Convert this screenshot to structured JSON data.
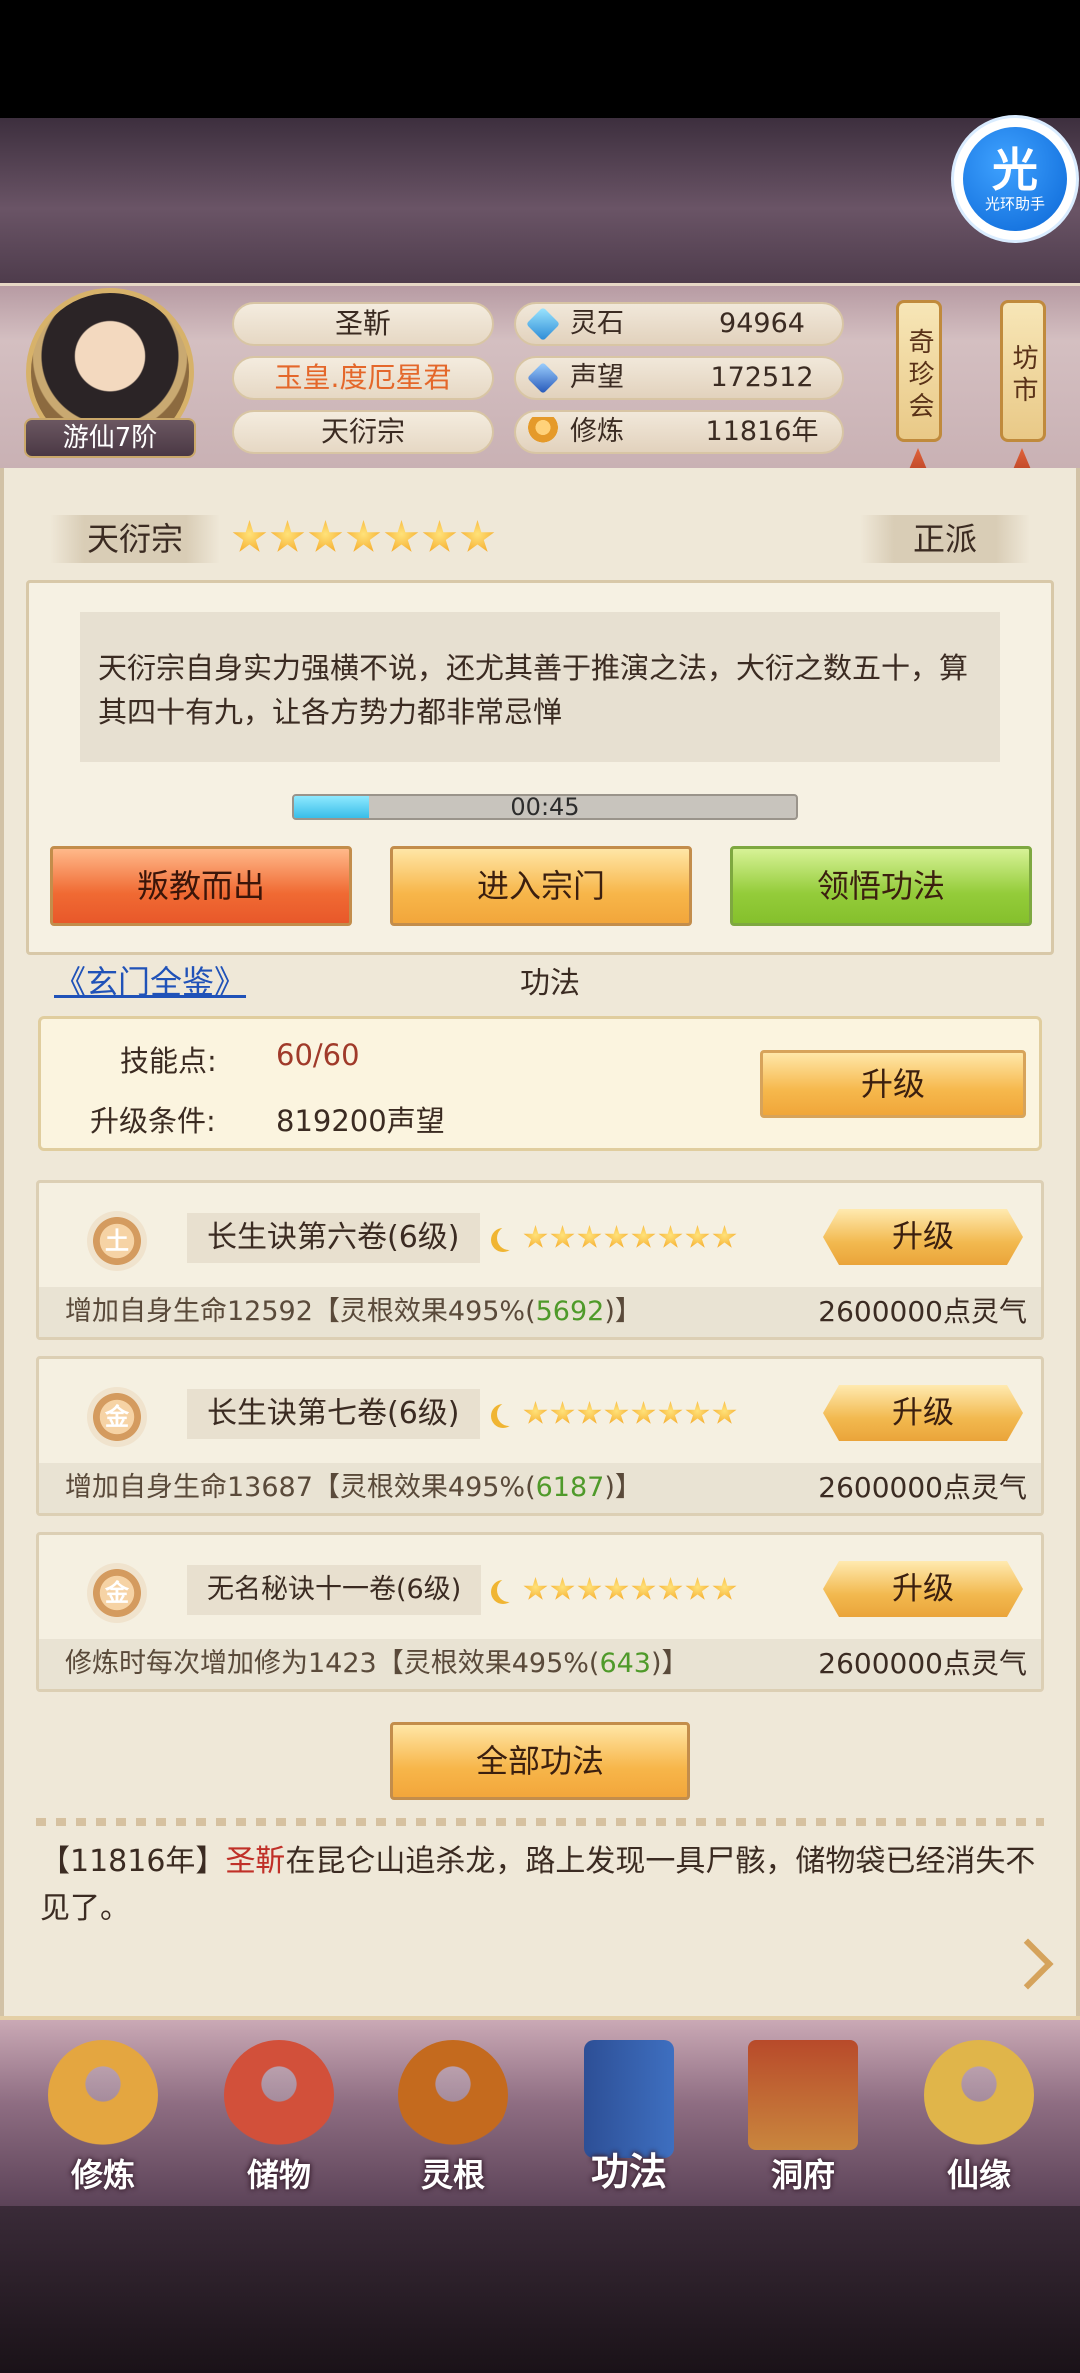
{
  "helper": {
    "big": "光",
    "small": "光环助手"
  },
  "player": {
    "name": "圣靳",
    "title": "玉皇.度厄星君",
    "sect": "天衍宗",
    "rank": "游仙7阶"
  },
  "resources": [
    {
      "icon": "spirit-stone-icon",
      "label": "灵石",
      "value": "94964"
    },
    {
      "icon": "reputation-icon",
      "label": "声望",
      "value": "172512"
    },
    {
      "icon": "meditation-icon",
      "label": "修炼",
      "value": "11816年"
    }
  ],
  "side_buttons": {
    "treasure": "奇珍会",
    "market": "坊市"
  },
  "sect_info": {
    "name": "天衍宗",
    "stars": 7,
    "faction": "正派",
    "description": "天衍宗自身实力强横不说，还尤其善于推演之法，大衍之数五十，算其四十有九，让各方势力都非常忌惮",
    "timer": "00:45",
    "timer_progress": 0.15
  },
  "actions": {
    "betray": "叛教而出",
    "enter": "进入宗门",
    "comprehend": "领悟功法"
  },
  "link": "《玄门全鉴》",
  "section_title": "功法",
  "skill_points": {
    "label": "技能点:",
    "value": "60/60",
    "cond_label": "升级条件:",
    "cond_value": "819200声望",
    "upgrade": "升级"
  },
  "techniques": [
    {
      "element": "土",
      "name": "长生诀第六卷(6级)",
      "stars": 8,
      "upgrade": "升级",
      "desc": "增加自身生命12592【灵根效果495%(",
      "bonus": "5692",
      "desc_end": ")】",
      "cost": "2600000点灵气"
    },
    {
      "element": "金",
      "name": "长生诀第七卷(6级)",
      "stars": 8,
      "upgrade": "升级",
      "desc": "增加自身生命13687【灵根效果495%(",
      "bonus": "6187",
      "desc_end": ")】",
      "cost": "2600000点灵气"
    },
    {
      "element": "金",
      "name": "无名秘诀十一卷(6级)",
      "stars": 8,
      "upgrade": "升级",
      "desc": "修炼时每次增加修为1423【灵根效果495%(",
      "bonus": "643",
      "desc_end": ")】",
      "cost": "2600000点灵气"
    }
  ],
  "all_techniques": "全部功法",
  "log": {
    "prefix": "【11816年】",
    "who": "圣靳",
    "text": "在昆仑山追杀龙，路上发现一具尸骸，储物袋已经消失不见了。"
  },
  "nav": [
    {
      "label": "修炼",
      "icon": "cultivate-icon",
      "color": "#e4a640"
    },
    {
      "label": "储物",
      "icon": "storage-bag-icon",
      "color": "#d2503a"
    },
    {
      "label": "灵根",
      "icon": "spirit-root-icon",
      "color": "#c46a1e"
    },
    {
      "label": "功法",
      "icon": "technique-book-icon",
      "color": "#3e6fc0"
    },
    {
      "label": "洞府",
      "icon": "cave-dwelling-icon",
      "color": "#c9863e"
    },
    {
      "label": "仙缘",
      "icon": "fortune-icon",
      "color": "#e0b54a"
    }
  ],
  "colors": {
    "accent_red": "#c03028",
    "link_blue": "#2052b8",
    "bonus_green": "#4f9a2a",
    "title_orange": "#e4672a"
  }
}
